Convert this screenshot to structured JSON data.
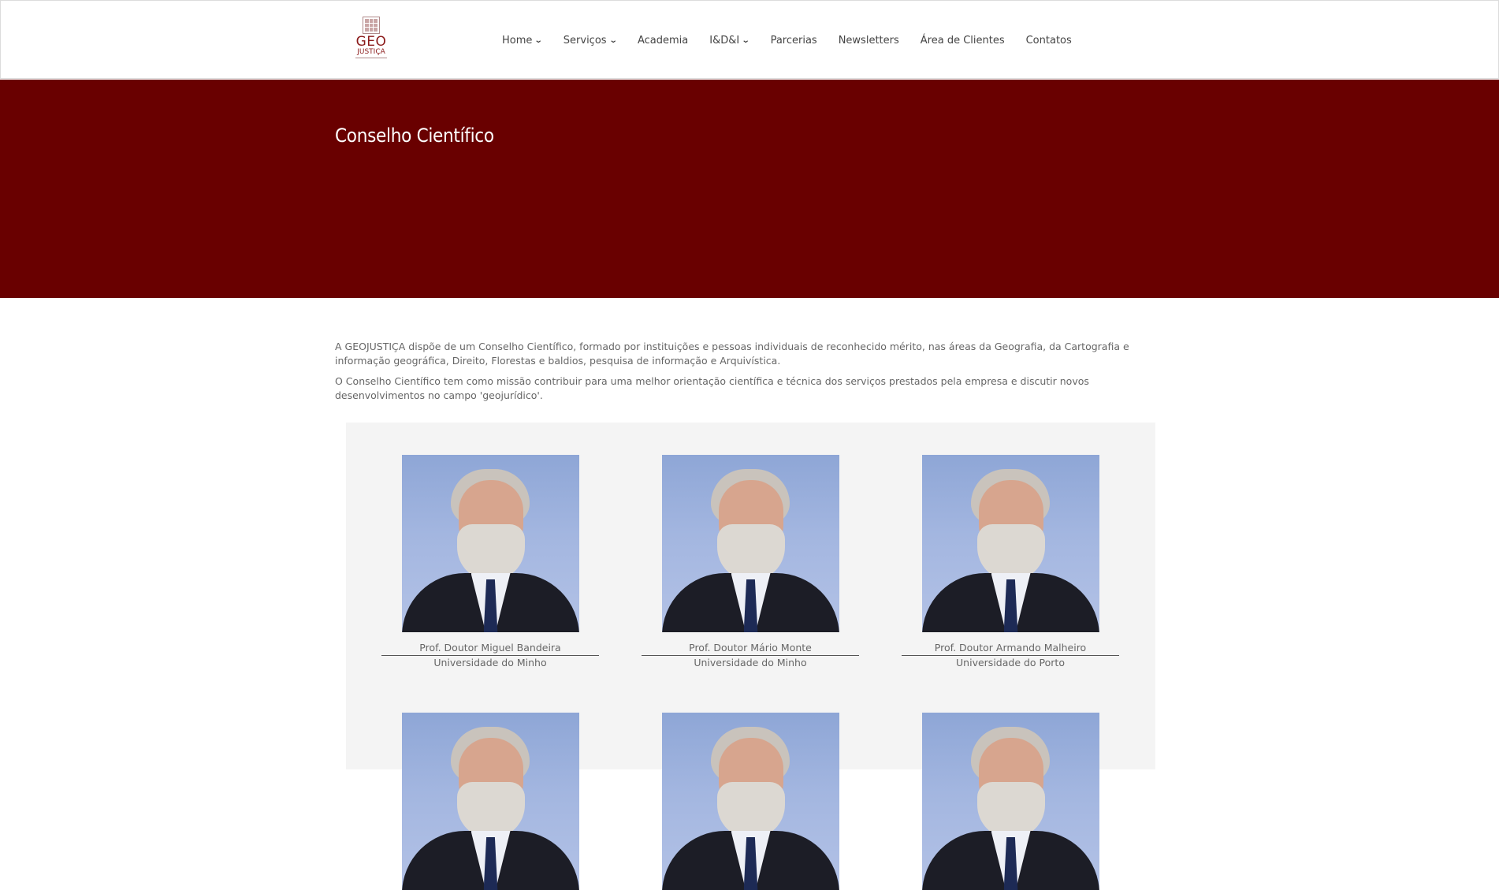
{
  "logo": {
    "line1": "GEO",
    "line2": "JUSTIÇA"
  },
  "nav": [
    {
      "label": "Home",
      "has_dropdown": true
    },
    {
      "label": "Serviços",
      "has_dropdown": true
    },
    {
      "label": "Academia",
      "has_dropdown": false
    },
    {
      "label": "I&D&I",
      "has_dropdown": true
    },
    {
      "label": "Parcerias",
      "has_dropdown": false
    },
    {
      "label": "Newsletters",
      "has_dropdown": false
    },
    {
      "label": "Área de Clientes",
      "has_dropdown": false
    },
    {
      "label": "Contatos",
      "has_dropdown": false
    }
  ],
  "banner": {
    "title": "Conselho Científico",
    "color": "#690000"
  },
  "intro": {
    "p1": "A GEOJUSTIÇA dispõe de um Conselho Científico, formado por instituições e pessoas individuais de reconhecido mérito, nas áreas da Geografia, da Cartografia e informação geográfica, Direito, Florestas e baldios, pesquisa de informação e Arquivística.",
    "p2": "O Conselho Científico tem como missão contribuir para uma melhor orientação científica e técnica dos serviços prestados pela empresa e discutir novos desenvolvimentos no campo 'geojurídico'."
  },
  "members": [
    {
      "name": "Prof. Doutor Miguel Bandeira",
      "institution": "Universidade do Minho"
    },
    {
      "name": "Prof. Doutor Mário Monte",
      "institution": "Universidade do Minho"
    },
    {
      "name": "Prof. Doutor Armando Malheiro",
      "institution": "Universidade do Porto"
    }
  ]
}
